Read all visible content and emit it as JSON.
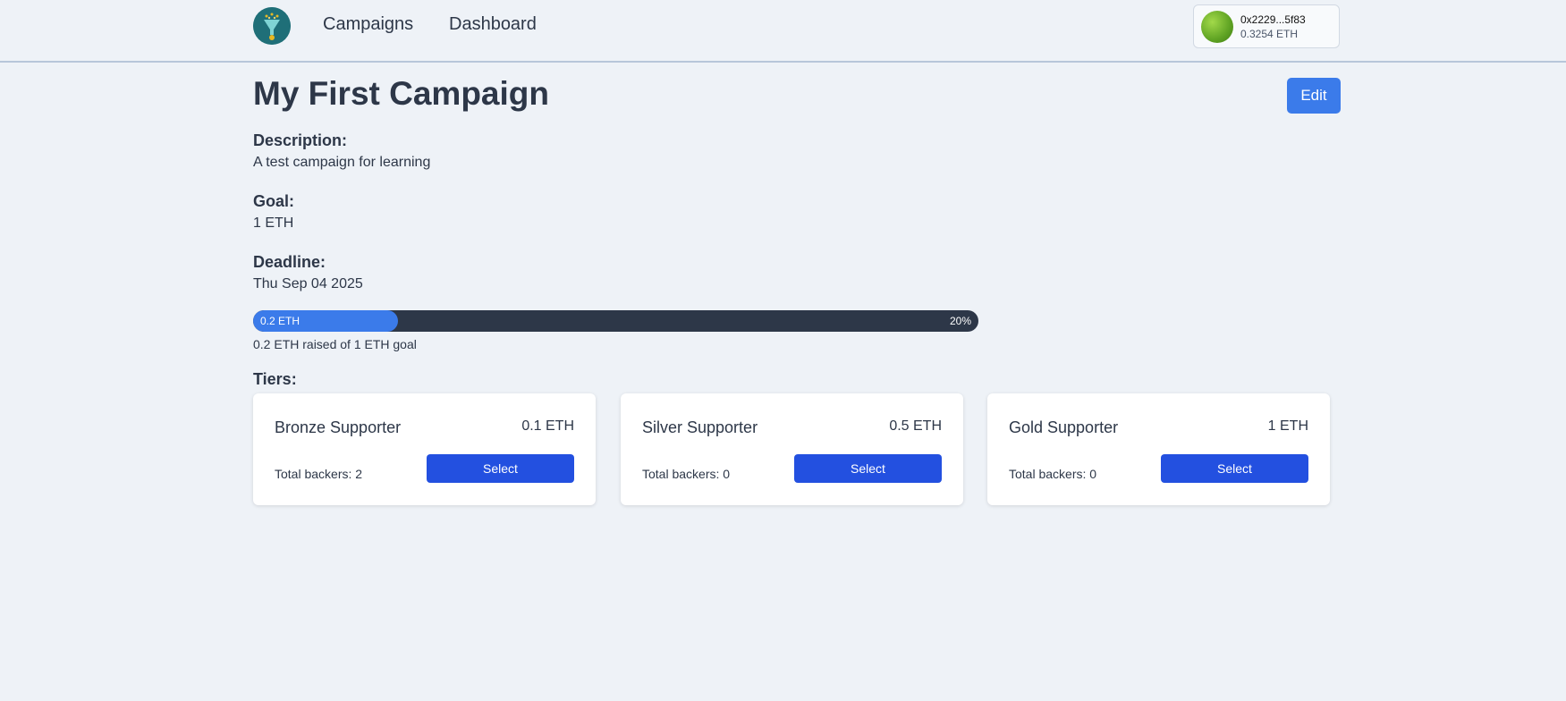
{
  "nav": {
    "logo_icon": "funnel-coin-icon",
    "links": [
      "Campaigns",
      "Dashboard"
    ]
  },
  "wallet": {
    "address": "0x2229...5f83",
    "balance": "0.3254 ETH"
  },
  "campaign": {
    "title": "My First Campaign",
    "edit_label": "Edit",
    "description_label": "Description:",
    "description": "A test campaign for learning",
    "goal_label": "Goal:",
    "goal": "1 ETH",
    "deadline_label": "Deadline:",
    "deadline": "Thu Sep 04 2025"
  },
  "progress": {
    "fraction": 0.2,
    "raised_label": "0.2 ETH",
    "percent_label": "20%",
    "caption": "0.2 ETH raised of 1 ETH goal"
  },
  "tiers_label": "Tiers:",
  "tiers": [
    {
      "name": "Bronze Supporter",
      "price": "0.1 ETH",
      "backers": "Total backers: 2",
      "button": "Select"
    },
    {
      "name": "Silver Supporter",
      "price": "0.5 ETH",
      "backers": "Total backers: 0",
      "button": "Select"
    },
    {
      "name": "Gold Supporter",
      "price": "1 ETH",
      "backers": "Total backers: 0",
      "button": "Select"
    }
  ],
  "colors": {
    "background": "#eef2f7",
    "accent": "#3b7bea",
    "select_button": "#2350e0",
    "progress_track": "#2d3748",
    "logo_bg": "#1f6f78"
  }
}
